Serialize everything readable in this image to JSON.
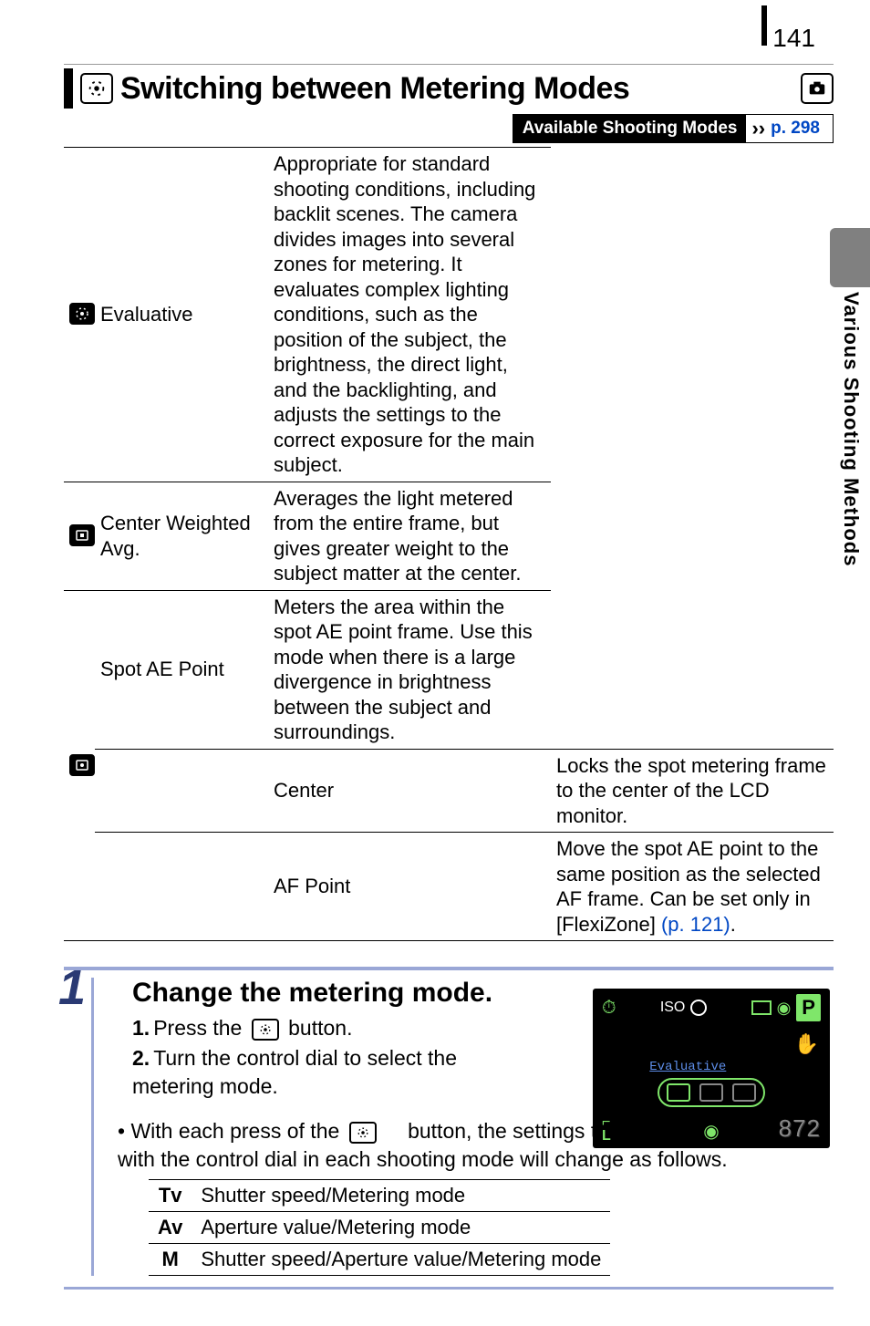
{
  "page_number": "141",
  "title": "Switching between Metering Modes",
  "available_modes_bar": {
    "label": "Available Shooting Modes",
    "link_text": "p. 298"
  },
  "side_section_label": "Various Shooting Methods",
  "metering_table": {
    "evaluative": {
      "name": "Evaluative",
      "desc": "Appropriate for standard shooting conditions, including backlit scenes. The camera divides images into several zones for metering. It evaluates complex lighting conditions, such as the position of the subject, the brightness, the direct light, and the backlighting, and adjusts the settings to the correct exposure for the main subject."
    },
    "center_weighted": {
      "name": "Center Weighted Avg.",
      "desc": "Averages the light metered from the entire frame, but gives greater weight to the subject matter at the center."
    },
    "spot": {
      "name": "Spot AE Point",
      "desc": "Meters the area within the spot AE point frame. Use this mode when there is a large divergence in brightness between the subject and surroundings.",
      "center": {
        "name": "Center",
        "desc": "Locks the spot metering frame to the center of the LCD monitor."
      },
      "afpoint": {
        "name": "AF Point",
        "desc_pre": "Move the spot AE point to the same position as the selected AF frame. Can be set only in [FlexiZone] ",
        "link": "(p. 121)",
        "desc_post": "."
      }
    }
  },
  "step": {
    "number": "1",
    "title": "Change the metering mode.",
    "sub1_pre": "Press the ",
    "sub1_post": " button.",
    "sub2": "Turn the control dial to select the metering mode.",
    "note_pre": "With each press of the ",
    "note_mid": " button, the settings that can be configured with the control dial in each shooting mode will change as follows.",
    "table": {
      "tv": {
        "label": "Tv",
        "desc": "Shutter speed/Metering mode"
      },
      "av": {
        "label": "Av",
        "desc": "Aperture value/Metering mode"
      },
      "m": {
        "label": "M",
        "desc": "Shutter speed/Aperture value/Metering mode"
      }
    }
  },
  "screenshot": {
    "iso_label": "ISO",
    "mode_badge": "P",
    "eval_label": "Evaluative",
    "shots_remaining": "872",
    "size_label_top": "⌐",
    "size_label_bot": "L"
  }
}
